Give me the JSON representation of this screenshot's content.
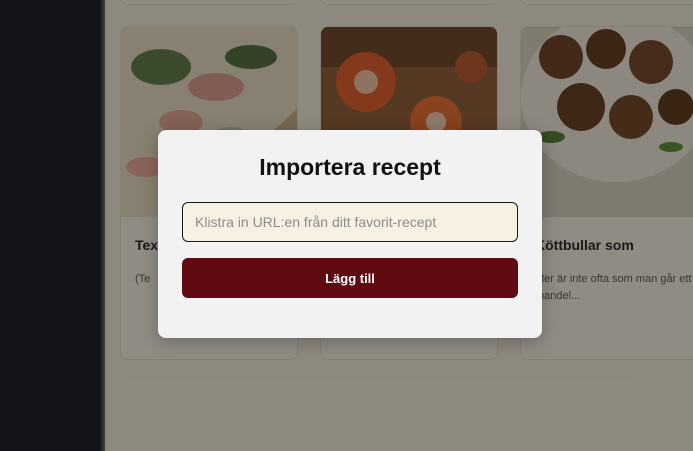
{
  "modal": {
    "title": "Importera recept",
    "url_placeholder": "Klistra in URL:en från ditt favorit-recept",
    "url_value": "",
    "add_label": "Lägg till"
  },
  "cards": [
    {
      "title": "Tex",
      "description": "(Te"
    },
    {
      "title": "",
      "description": ""
    },
    {
      "title": "Köttbullar som",
      "description": "Mer är inte ofta som man går ett mandel..."
    }
  ],
  "colors": {
    "sidebar": "#121620",
    "page_background": "#f2ecdd",
    "modal_background": "#f2f2f2",
    "input_background": "#f7f1e2",
    "primary_button": "#600b12"
  }
}
